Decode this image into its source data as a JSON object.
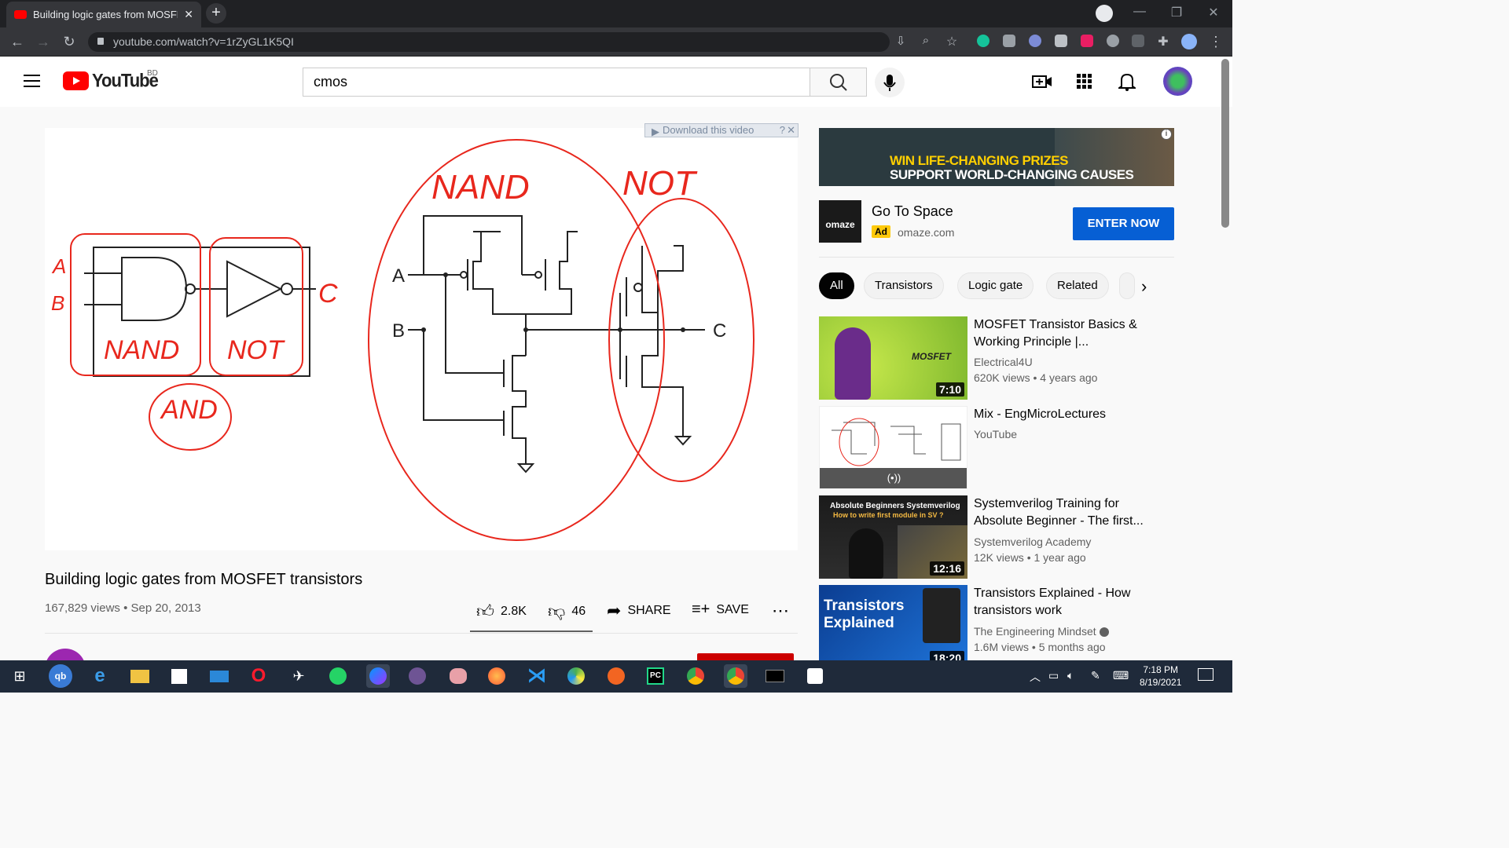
{
  "browser": {
    "tab_title": "Building logic gates from MOSFE",
    "url": "youtube.com/watch?v=1rZyGL1K5QI"
  },
  "youtube": {
    "logo_text": "YouTube",
    "country": "BD",
    "search_value": "cmos"
  },
  "player": {
    "download_label": "Download this video",
    "whiteboard": {
      "labels": [
        "A",
        "B",
        "NAND",
        "NOT",
        "C",
        "AND",
        "NAND",
        "NOT",
        "A",
        "B",
        "C"
      ]
    }
  },
  "video": {
    "title": "Building logic gates from MOSFET transistors",
    "views_date": "167,829 views • Sep 20, 2013",
    "likes": "2.8K",
    "dislikes": "46",
    "share_label": "SHARE",
    "save_label": "SAVE"
  },
  "ad": {
    "banner_line1": "WIN LIFE-CHANGING PRIZES",
    "banner_line2": "SUPPORT WORLD-CHANGING CAUSES",
    "brand_logo": "omaze",
    "title": "Go To Space",
    "badge": "Ad",
    "domain": "omaze.com",
    "cta": "ENTER NOW"
  },
  "chips": [
    "All",
    "Transistors",
    "Logic gate",
    "Related"
  ],
  "recommendations": [
    {
      "title": "MOSFET Transistor Basics & Working Principle |...",
      "channel": "Electrical4U",
      "meta": "620K views • 4 years ago",
      "duration": "7:10",
      "thumb_text": "MOSFET"
    },
    {
      "title": "Mix - EngMicroLectures",
      "channel": "YouTube",
      "meta": "",
      "duration": "",
      "thumb_text": "(•))"
    },
    {
      "title": "Systemverilog Training for Absolute Beginner - The first...",
      "channel": "Systemverilog Academy",
      "meta": "12K views • 1 year ago",
      "duration": "12:16",
      "thumb_text": "Absolute Beginners Systemverilog",
      "thumb_sub": "How to write first module in SV ?"
    },
    {
      "title": "Transistors Explained - How transistors work",
      "channel": "The Engineering Mindset",
      "meta": "1.6M views • 5 months ago",
      "duration": "18:20",
      "thumb_text": "Transistors Explained"
    }
  ],
  "taskbar": {
    "time": "7:18 PM",
    "date": "8/19/2021"
  },
  "colors": {
    "youtube_red": "#ff0000",
    "ad_blue": "#065fd4",
    "ink_red": "#e8271d"
  }
}
